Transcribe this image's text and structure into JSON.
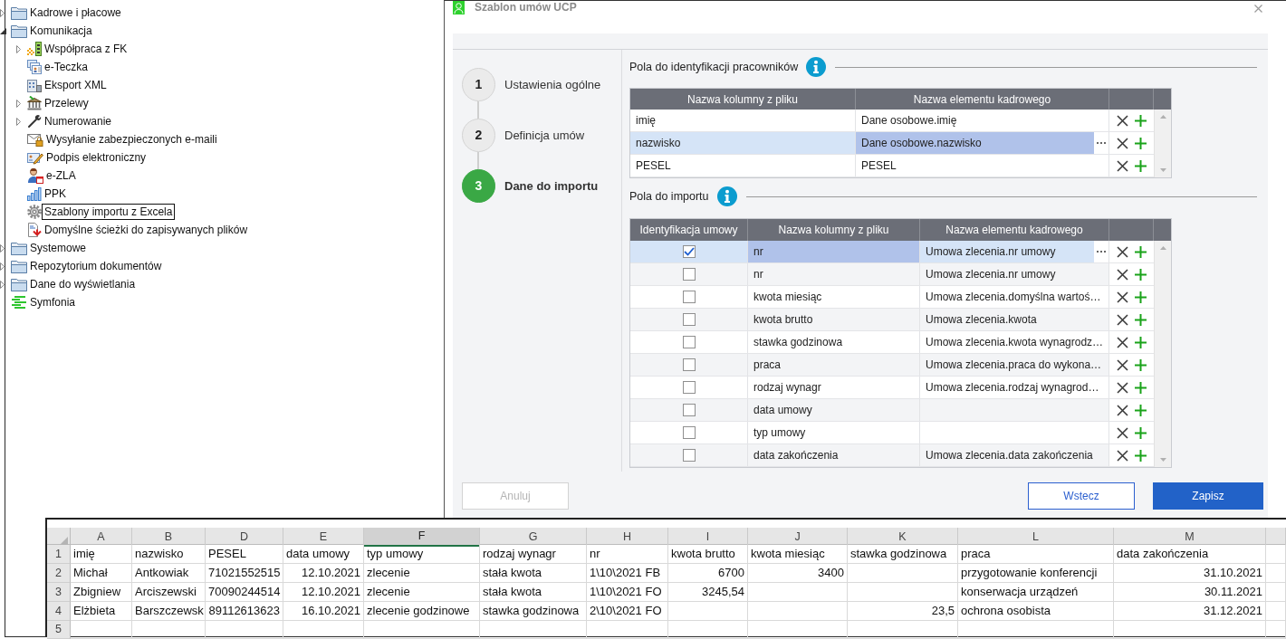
{
  "tree": [
    {
      "label": "Kadrowe i płacowe",
      "kind": "folder",
      "expanded": false,
      "selected": false
    },
    {
      "label": "Komunikacja",
      "kind": "folder",
      "expanded": true,
      "selected": false,
      "children": [
        {
          "label": "Współpraca z FK",
          "kind": "blocks",
          "expanded": false,
          "selected": false
        },
        {
          "label": "e-Teczka",
          "kind": "cards",
          "selected": false
        },
        {
          "label": "Eksport XML",
          "kind": "building",
          "selected": false
        },
        {
          "label": "Przelewy",
          "kind": "bank",
          "expanded": false,
          "selected": false
        },
        {
          "label": "Numerowanie",
          "kind": "wrench",
          "expanded": false,
          "selected": false
        },
        {
          "label": "Wysyłanie zabezpieczonych e-maili",
          "kind": "mail",
          "selected": false
        },
        {
          "label": "Podpis elektroniczny",
          "kind": "pen",
          "selected": false
        },
        {
          "label": "e-ZLA",
          "kind": "person",
          "selected": false
        },
        {
          "label": "PPK",
          "kind": "chart",
          "selected": false
        },
        {
          "label": "Szablony importu z Excela",
          "kind": "gear",
          "selected": true
        },
        {
          "label": "Domyślne ścieżki do zapisywanych plików",
          "kind": "document",
          "selected": false
        }
      ]
    },
    {
      "label": "Systemowe",
      "kind": "folder",
      "expanded": false,
      "selected": false
    },
    {
      "label": "Repozytorium dokumentów",
      "kind": "folder",
      "expanded": false,
      "selected": false
    },
    {
      "label": "Dane do wyświetlania",
      "kind": "folder",
      "expanded": false,
      "selected": false
    },
    {
      "label": "Symfonia",
      "kind": "stripes",
      "selected": false
    }
  ],
  "dialog": {
    "title": "Szablon umów UCP",
    "steps": [
      {
        "number": "1",
        "label": "Ustawienia ogólne",
        "selected": false
      },
      {
        "number": "2",
        "label": "Definicja umów",
        "selected": false
      },
      {
        "number": "3",
        "label": "Dane do importu",
        "selected": true
      }
    ],
    "employee_fields": {
      "title": "Pola do identyfikacji pracowników",
      "columns": [
        "Nazwa kolumny z pliku",
        "Nazwa elementu kadrowego"
      ],
      "rows": [
        {
          "cells": [
            {
              "text": "imię",
              "focused": false
            },
            {
              "text": "Dane osobowe.imię",
              "focused": false
            }
          ],
          "selected": false
        },
        {
          "cells": [
            {
              "text": "nazwisko",
              "focused": false
            },
            {
              "text": "Dane osobowe.nazwisko",
              "focused": true
            }
          ],
          "selected": true
        },
        {
          "cells": [
            {
              "text": "PESEL",
              "focused": false
            },
            {
              "text": "PESEL",
              "focused": false
            }
          ],
          "selected": false
        }
      ]
    },
    "import_fields": {
      "title": "Pola do importu",
      "columns": [
        "Identyfikacja umowy",
        "Nazwa kolumny z pliku",
        "Nazwa elementu kadrowego"
      ],
      "rows": [
        {
          "checked": true,
          "cells": [
            {
              "text": "nr",
              "focused": true
            },
            {
              "text": "Umowa zlecenia.nr umowy",
              "focused": false
            }
          ],
          "selected": true
        },
        {
          "checked": false,
          "cells": [
            {
              "text": "nr",
              "focused": false
            },
            {
              "text": "Umowa zlecenia.nr umowy",
              "focused": false
            }
          ],
          "selected": false
        },
        {
          "checked": false,
          "cells": [
            {
              "text": "kwota miesiąc",
              "focused": false
            },
            {
              "text": "Umowa zlecenia.domyślna wartoś…",
              "focused": false
            }
          ],
          "selected": false
        },
        {
          "checked": false,
          "cells": [
            {
              "text": "kwota brutto",
              "focused": false
            },
            {
              "text": "Umowa zlecenia.kwota",
              "focused": false
            }
          ],
          "selected": false
        },
        {
          "checked": false,
          "cells": [
            {
              "text": "stawka godzinowa",
              "focused": false
            },
            {
              "text": "Umowa zlecenia.kwota wynagrodz…",
              "focused": false
            }
          ],
          "selected": false
        },
        {
          "checked": false,
          "cells": [
            {
              "text": "praca",
              "focused": false
            },
            {
              "text": "Umowa zlecenia.praca do wykona…",
              "focused": false
            }
          ],
          "selected": false
        },
        {
          "checked": false,
          "cells": [
            {
              "text": "rodzaj wynagr",
              "focused": false
            },
            {
              "text": "Umowa zlecenia.rodzaj wynagrod…",
              "focused": false
            }
          ],
          "selected": false
        },
        {
          "checked": false,
          "cells": [
            {
              "text": "data umowy",
              "focused": false
            }
          ],
          "selected": false
        },
        {
          "checked": false,
          "cells": [
            {
              "text": "typ umowy",
              "focused": false
            }
          ],
          "selected": false
        },
        {
          "checked": false,
          "cells": [
            {
              "text": "data zakończenia",
              "focused": false
            },
            {
              "text": "Umowa zlecenia.data zakończenia",
              "focused": false
            }
          ],
          "selected": false
        }
      ]
    },
    "buttons": [
      {
        "label": "Anuluj",
        "kind": "secondary",
        "disabled": true
      },
      {
        "label": "Wstecz",
        "kind": "outline",
        "disabled": false
      },
      {
        "label": "Zapisz",
        "kind": "primary",
        "disabled": false
      }
    ]
  },
  "spreadsheet": {
    "columns": [
      {
        "letter": "A",
        "selected": false
      },
      {
        "letter": "B",
        "selected": false
      },
      {
        "letter": "D",
        "selected": false
      },
      {
        "letter": "E",
        "selected": false
      },
      {
        "letter": "F",
        "selected": true
      },
      {
        "letter": "G",
        "selected": false
      },
      {
        "letter": "H",
        "selected": false
      },
      {
        "letter": "I",
        "selected": false
      },
      {
        "letter": "J",
        "selected": false
      },
      {
        "letter": "K",
        "selected": false
      },
      {
        "letter": "L",
        "selected": false
      },
      {
        "letter": "M",
        "selected": false
      }
    ],
    "rows": [
      {
        "number": "1",
        "cells": [
          {
            "kind": "text",
            "text": "imię"
          },
          {
            "kind": "text",
            "text": "nazwisko"
          },
          {
            "kind": "text",
            "text": "PESEL"
          },
          {
            "kind": "text",
            "text": "data umowy"
          },
          {
            "kind": "text",
            "text": "typ umowy"
          },
          {
            "kind": "text",
            "text": "rodzaj wynagr"
          },
          {
            "kind": "text",
            "text": "nr"
          },
          {
            "kind": "text",
            "text": "kwota brutto"
          },
          {
            "kind": "text",
            "text": "kwota miesiąc"
          },
          {
            "kind": "text",
            "text": "stawka godzinowa"
          },
          {
            "kind": "text",
            "text": "praca"
          },
          {
            "kind": "text",
            "text": "data zakończenia"
          }
        ]
      },
      {
        "number": "2",
        "cells": [
          {
            "kind": "text",
            "text": "Michał"
          },
          {
            "kind": "text",
            "text": "Antkowiak"
          },
          {
            "kind": "number",
            "text": "71021552515"
          },
          {
            "kind": "date",
            "text": "12.10.2021"
          },
          {
            "kind": "text",
            "text": "zlecenie"
          },
          {
            "kind": "text",
            "text": "stała kwota"
          },
          {
            "kind": "text",
            "text": "1\\10\\2021 FB"
          },
          {
            "kind": "number",
            "text": "6700"
          },
          {
            "kind": "number",
            "text": "3400"
          },
          null,
          {
            "kind": "text",
            "text": "przygotowanie konferencji"
          },
          {
            "kind": "date",
            "text": "31.10.2021"
          }
        ]
      },
      {
        "number": "3",
        "cells": [
          {
            "kind": "text",
            "text": "Zbigniew"
          },
          {
            "kind": "text",
            "text": "Arciszewski"
          },
          {
            "kind": "number",
            "text": "70090244514"
          },
          {
            "kind": "date",
            "text": "12.10.2021"
          },
          {
            "kind": "text",
            "text": "zlecenie"
          },
          {
            "kind": "text",
            "text": "stała kwota"
          },
          {
            "kind": "text",
            "text": "1\\10\\2021 FO"
          },
          {
            "kind": "number",
            "text": "3245,54"
          },
          null,
          null,
          {
            "kind": "text",
            "text": "konserwacja urządzeń"
          },
          {
            "kind": "date",
            "text": "30.11.2021"
          }
        ]
      },
      {
        "number": "4",
        "cells": [
          {
            "kind": "text",
            "text": "Elżbieta"
          },
          {
            "kind": "text",
            "text": "Barszczewsk"
          },
          {
            "kind": "number",
            "text": "89112613623"
          },
          {
            "kind": "date",
            "text": "16.10.2021"
          },
          {
            "kind": "text",
            "text": "zlecenie godzinowe"
          },
          {
            "kind": "text",
            "text": "stawka godzinowa"
          },
          {
            "kind": "text",
            "text": "2\\10\\2021 FO"
          },
          null,
          null,
          {
            "kind": "number",
            "text": "23,5"
          },
          {
            "kind": "text",
            "text": "ochrona osobista"
          },
          {
            "kind": "date",
            "text": "31.12.2021"
          }
        ]
      },
      {
        "number": "5"
      }
    ]
  }
}
